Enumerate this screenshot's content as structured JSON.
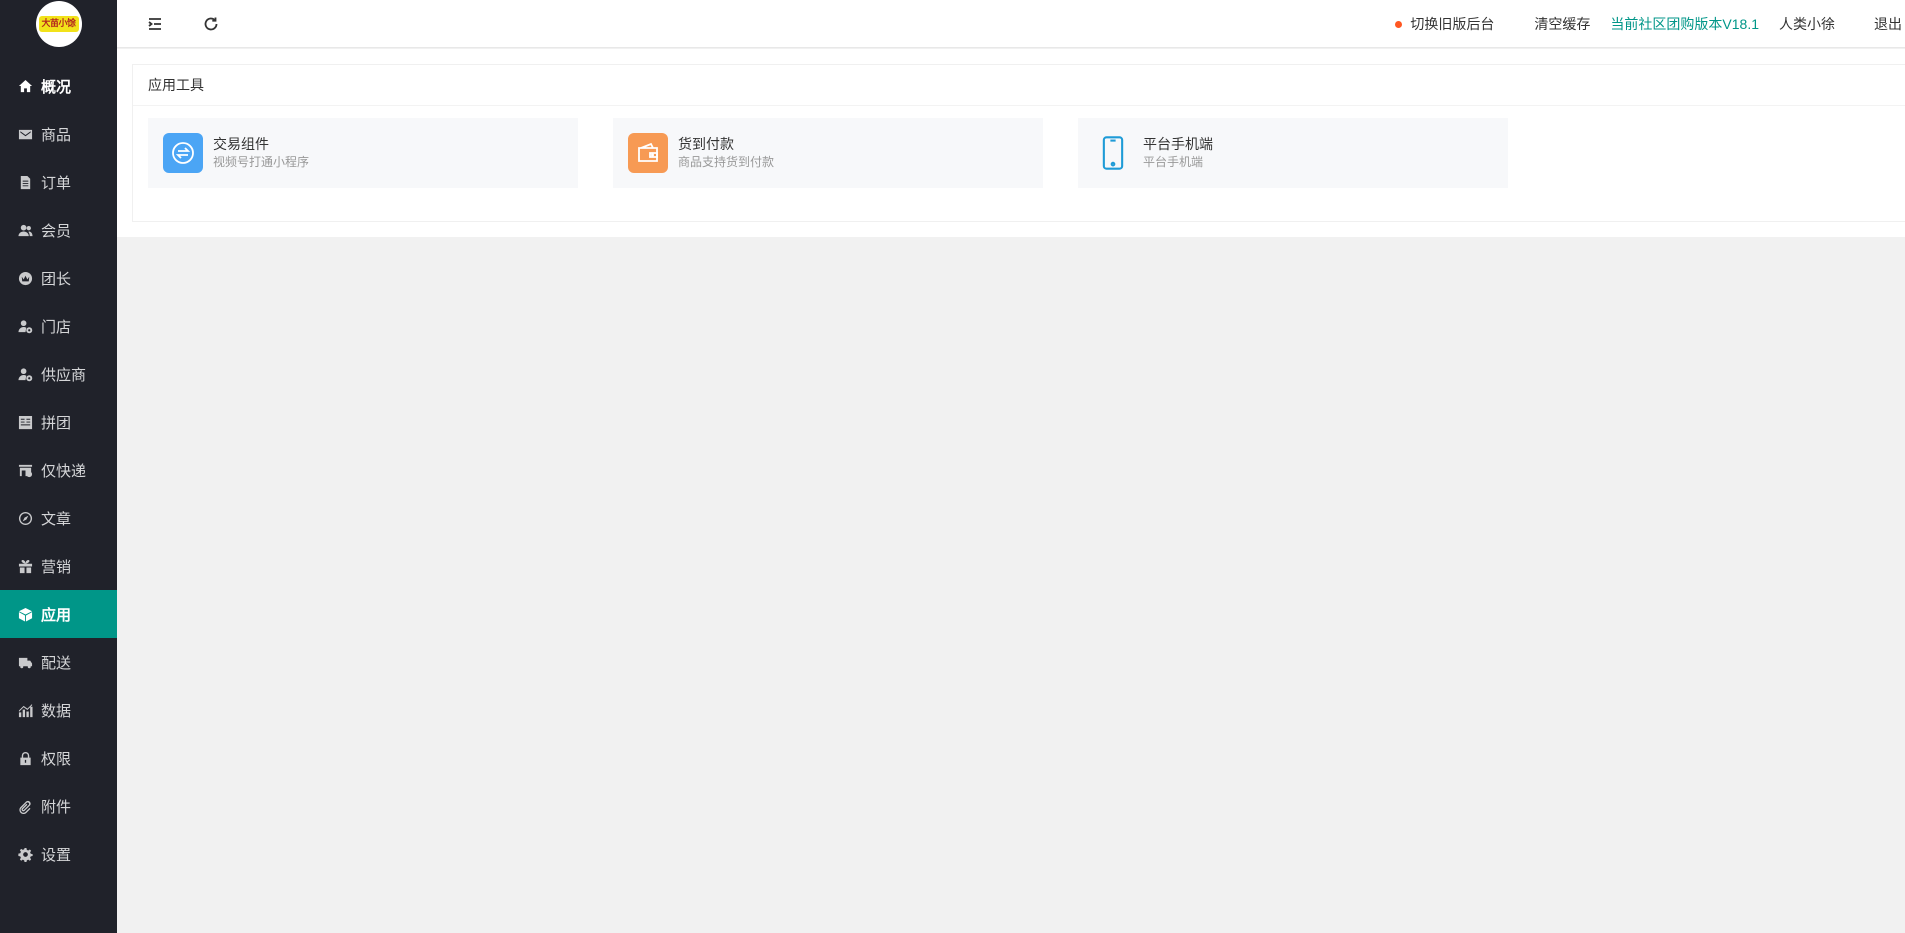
{
  "sidebar": {
    "logo_text": "大苗小馀",
    "items": [
      {
        "label": "概况",
        "icon": "home-icon"
      },
      {
        "label": "商品",
        "icon": "envelope-icon"
      },
      {
        "label": "订单",
        "icon": "file-icon"
      },
      {
        "label": "会员",
        "icon": "users-icon"
      },
      {
        "label": "团长",
        "icon": "crown-icon"
      },
      {
        "label": "门店",
        "icon": "user-gear-icon"
      },
      {
        "label": "供应商",
        "icon": "user-gear-icon"
      },
      {
        "label": "拼团",
        "icon": "grid-icon"
      },
      {
        "label": "仅快递",
        "icon": "store-icon"
      },
      {
        "label": "文章",
        "icon": "compass-icon"
      },
      {
        "label": "营销",
        "icon": "gift-icon"
      },
      {
        "label": "应用",
        "icon": "cube-icon"
      },
      {
        "label": "配送",
        "icon": "truck-icon"
      },
      {
        "label": "数据",
        "icon": "bar-chart-icon"
      },
      {
        "label": "权限",
        "icon": "lock-icon"
      },
      {
        "label": "附件",
        "icon": "paperclip-icon"
      },
      {
        "label": "设置",
        "icon": "gear-icon"
      }
    ],
    "active_item": "应用",
    "active_color": "#009688"
  },
  "header": {
    "switch_old": "切换旧版后台",
    "clear_cache": "清空缓存",
    "version": "当前社区团购版本V18.1",
    "username": "人类小徐",
    "logout": "退出",
    "dot_color": "#ff5722",
    "accent_color": "#009688"
  },
  "main": {
    "card_title": "应用工具",
    "tools": [
      {
        "title": "交易组件",
        "desc": "视频号打通小程序",
        "icon": "exchange-icon",
        "color": "#4ba5f5"
      },
      {
        "title": "货到付款",
        "desc": "商品支持货到付款",
        "icon": "wallet-icon",
        "color": "#f79a54"
      },
      {
        "title": "平台手机端",
        "desc": "平台手机端",
        "icon": "phone-icon",
        "color": "#1e9bd7"
      }
    ]
  }
}
